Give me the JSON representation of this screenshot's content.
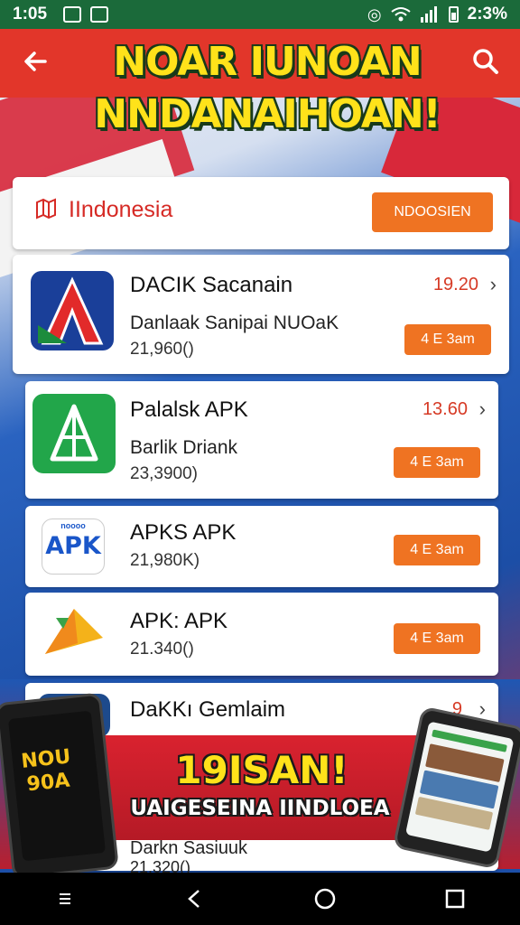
{
  "status_bar": {
    "time": "1:05",
    "battery_text": "2:3%"
  },
  "header": {
    "title_line1": "NOAR IUNOAN",
    "title_line2": "NNDANAIHOAN!"
  },
  "region": {
    "label": "IIndonesia",
    "button": "NDOOSIEN"
  },
  "apps": [
    {
      "name": "DACIK Sacanain",
      "subtitle": "Danlaak Sanipai NUOaK",
      "count": "21,960()",
      "price": "19.20",
      "button": "4 E 3am",
      "icon": "red-triangle-app-icon"
    },
    {
      "name": "Palalsk APK",
      "subtitle": "Barlik Driank",
      "count": "23,3900)",
      "price": "13.60",
      "button": "4 E 3am",
      "icon": "green-triangle-app-icon"
    },
    {
      "name": "APKS APK",
      "subtitle": "",
      "count": "21,980K)",
      "price": "",
      "button": "4 E 3am",
      "icon": "apk-logo-icon"
    },
    {
      "name": "APK: APK",
      "subtitle": "",
      "count": "21.340()",
      "price": "",
      "button": "4 E 3am",
      "icon": "yellow-arrow-app-icon"
    },
    {
      "name": "DaKKı Gemlaim",
      "subtitle": "",
      "count": "",
      "price": "9",
      "button": "",
      "icon": "dark-app-icon"
    }
  ],
  "promo": {
    "headline": "19ISAN!",
    "subline": "UAIGESEINA IINDLOEA",
    "phone_text": "NOU 90A"
  },
  "peek_item": {
    "name": "Darkn Sasiuuk",
    "count": "21.320()"
  },
  "colors": {
    "status_bar": "#1b6a3a",
    "header": "#e2362a",
    "accent_orange": "#ef7322",
    "price_red": "#d63a25",
    "title_yellow": "#ffe21a"
  }
}
